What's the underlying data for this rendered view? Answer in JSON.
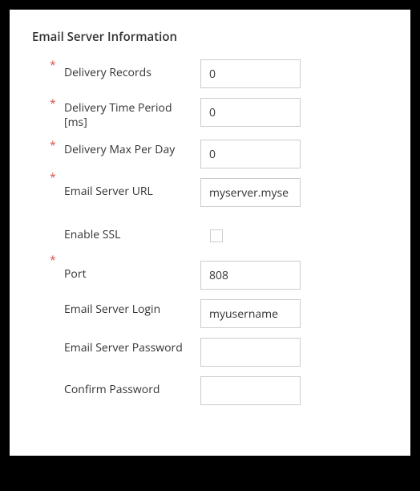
{
  "section": {
    "title": "Email Server Information"
  },
  "fields": {
    "deliveryRecords": {
      "label": "Delivery Records",
      "value": "0",
      "required": true
    },
    "deliveryTimePeriod": {
      "label": "Delivery Time Period [ms]",
      "value": "0",
      "required": true
    },
    "deliveryMaxPerDay": {
      "label": "Delivery Max Per Day",
      "value": "0",
      "required": true
    },
    "emailServerUrl": {
      "label": "Email Server URL",
      "value": "myserver.myse",
      "required": true
    },
    "enableSsl": {
      "label": "Enable SSL",
      "checked": false,
      "required": false
    },
    "port": {
      "label": "Port",
      "value": "808",
      "required": true
    },
    "emailServerLogin": {
      "label": "Email Server Login",
      "value": "myusername",
      "required": false
    },
    "emailServerPassword": {
      "label": "Email Server Password",
      "value": "",
      "required": false
    },
    "confirmPassword": {
      "label": "Confirm Password",
      "value": "",
      "required": false
    }
  }
}
